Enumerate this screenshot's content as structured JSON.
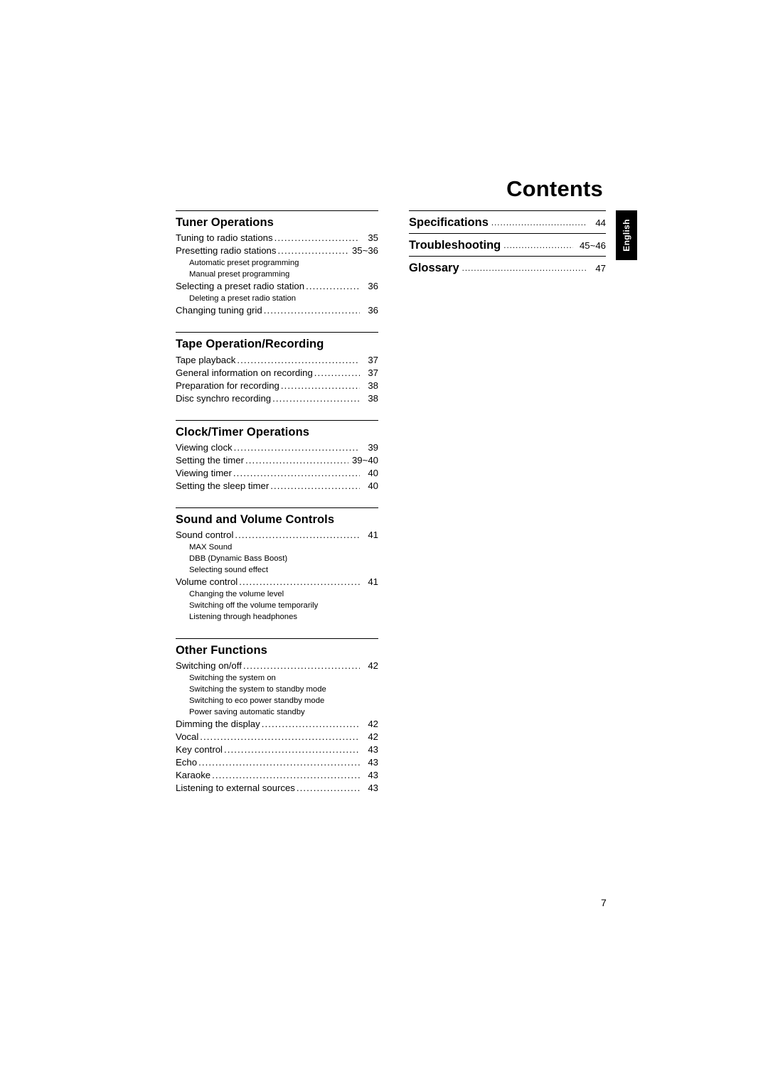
{
  "page": {
    "title": "Contents",
    "folio": "7",
    "side_tab_label": "English"
  },
  "left_column": [
    {
      "heading": "Tuner Operations",
      "entries": [
        {
          "text": "Tuning to radio stations",
          "page": "35",
          "level": 1
        },
        {
          "text": "Presetting radio stations",
          "page": "35~36",
          "level": 1,
          "wide": true
        },
        {
          "text": "Automatic preset programming",
          "level": 2
        },
        {
          "text": "Manual preset programming",
          "level": 2
        },
        {
          "text": "Selecting a preset radio station",
          "page": "36",
          "level": 1
        },
        {
          "text": "Deleting a preset radio station",
          "level": 2
        },
        {
          "text": "Changing tuning grid",
          "page": "36",
          "level": 1
        }
      ]
    },
    {
      "heading": "Tape Operation/Recording",
      "entries": [
        {
          "text": "Tape playback",
          "page": "37",
          "level": 1
        },
        {
          "text": "General information on recording",
          "page": "37",
          "level": 1
        },
        {
          "text": "Preparation for recording",
          "page": "38",
          "level": 1
        },
        {
          "text": "Disc synchro recording",
          "page": "38",
          "level": 1
        }
      ]
    },
    {
      "heading": "Clock/Timer Operations",
      "entries": [
        {
          "text": "Viewing clock",
          "page": "39",
          "level": 1
        },
        {
          "text": "Setting the timer",
          "page": "39~40",
          "level": 1,
          "wide": true
        },
        {
          "text": "Viewing timer",
          "page": "40",
          "level": 1
        },
        {
          "text": "Setting the sleep timer",
          "page": "40",
          "level": 1
        }
      ]
    },
    {
      "heading": "Sound and Volume Controls",
      "entries": [
        {
          "text": "Sound control",
          "page": "41",
          "level": 1
        },
        {
          "text": "MAX Sound",
          "level": 2
        },
        {
          "text": "DBB (Dynamic Bass Boost)",
          "level": 2
        },
        {
          "text": "Selecting sound effect",
          "level": 2
        },
        {
          "text": "Volume control",
          "page": "41",
          "level": 1
        },
        {
          "text": "Changing the volume level",
          "level": 2
        },
        {
          "text": "Switching off the volume temporarily",
          "level": 2
        },
        {
          "text": "Listening through headphones",
          "level": 2
        }
      ]
    },
    {
      "heading": "Other Functions",
      "entries": [
        {
          "text": "Switching on/off",
          "page": "42",
          "level": 1
        },
        {
          "text": "Switching the system on",
          "level": 2
        },
        {
          "text": "Switching the system to standby mode",
          "level": 2
        },
        {
          "text": "Switching to eco power standby mode",
          "level": 2
        },
        {
          "text": "Power saving automatic standby",
          "level": 2
        },
        {
          "text": "Dimming the display",
          "page": "42",
          "level": 1
        },
        {
          "text": "Vocal",
          "page": "42",
          "level": 1
        },
        {
          "text": "Key control",
          "page": "43",
          "level": 1
        },
        {
          "text": "Echo",
          "page": "43",
          "level": 1
        },
        {
          "text": "Karaoke",
          "page": "43",
          "level": 1
        },
        {
          "text": "Listening to external sources",
          "page": "43",
          "level": 1
        }
      ]
    }
  ],
  "right_column": [
    {
      "text": "Specifications",
      "page": "44",
      "wide": false
    },
    {
      "text": "Troubleshooting",
      "page": "45~46",
      "wide": true
    },
    {
      "text": "Glossary",
      "page": "47",
      "wide": false
    }
  ]
}
